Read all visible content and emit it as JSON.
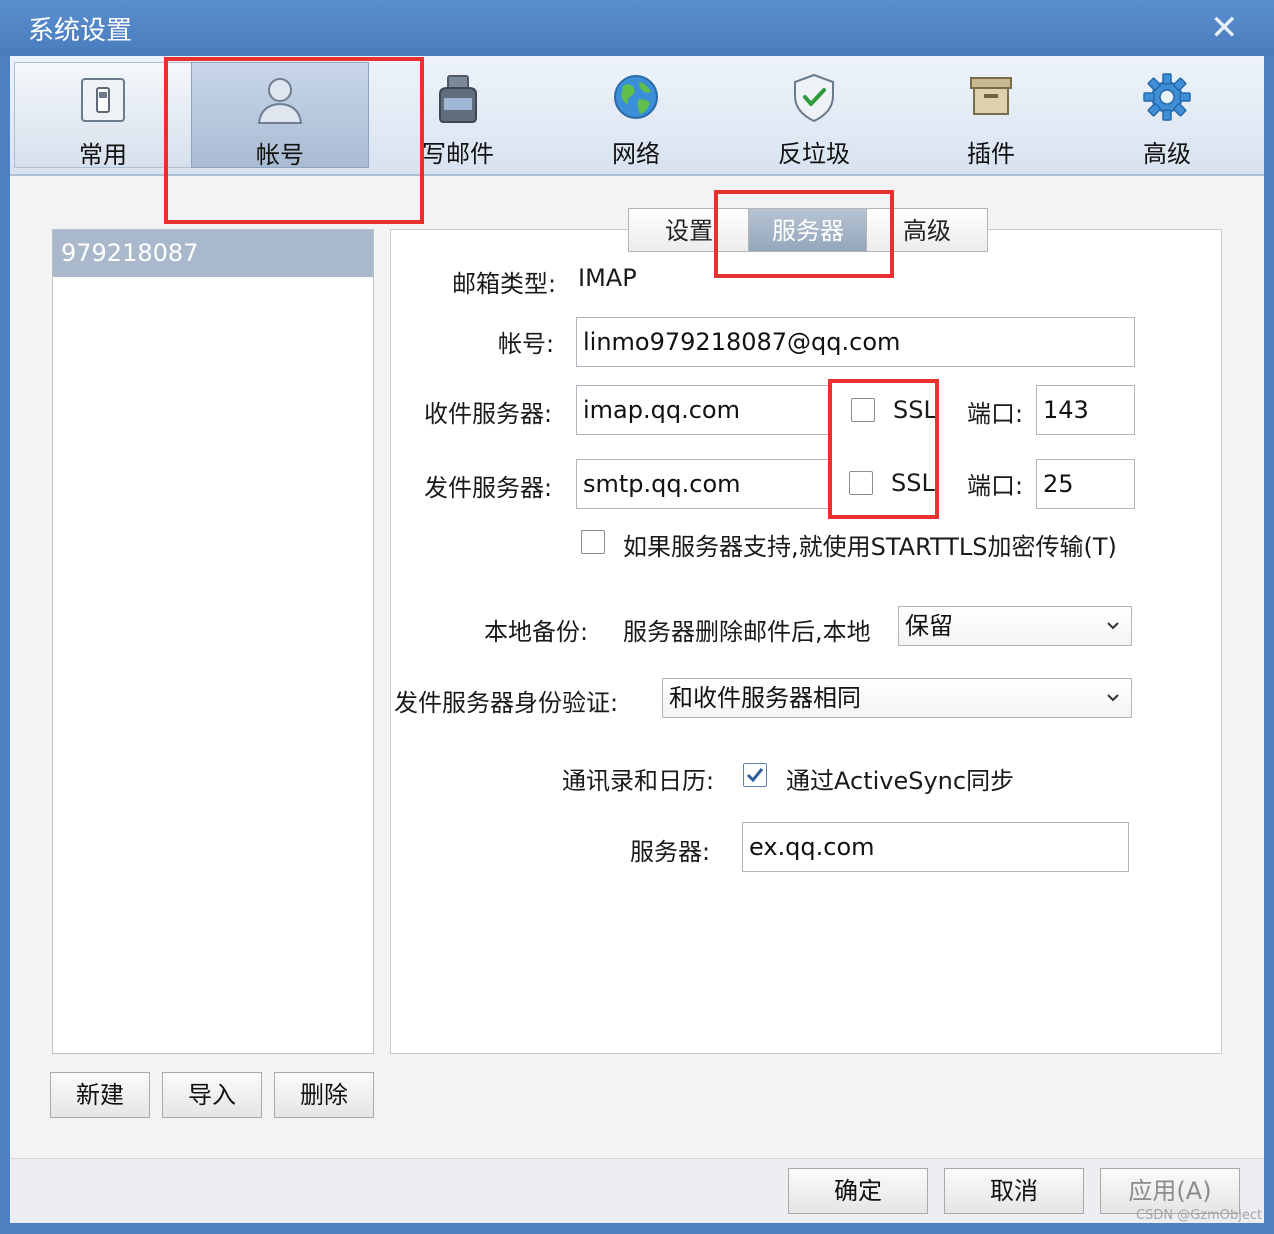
{
  "window": {
    "title": "系统设置",
    "close_glyph": "✕"
  },
  "toolbar": {
    "items": [
      {
        "label": "常用",
        "icon": "switch-icon"
      },
      {
        "label": "帐号",
        "icon": "user-icon"
      },
      {
        "label": "写邮件",
        "icon": "ink-bottle-icon"
      },
      {
        "label": "网络",
        "icon": "globe-icon"
      },
      {
        "label": "反垃圾",
        "icon": "shield-icon"
      },
      {
        "label": "插件",
        "icon": "box-icon"
      },
      {
        "label": "高级",
        "icon": "gear-icon"
      }
    ],
    "active": "帐号"
  },
  "accounts": {
    "items": [
      "979218087"
    ],
    "selected": "979218087"
  },
  "account_buttons": {
    "new": "新建",
    "import": "导入",
    "delete": "删除"
  },
  "tabs": {
    "items": [
      "设置",
      "服务器",
      "高级"
    ],
    "active": "服务器"
  },
  "server": {
    "mailbox_type_label": "邮箱类型:",
    "mailbox_type_value": "IMAP",
    "account_label": "帐号:",
    "account_value": "linmo979218087@qq.com",
    "incoming_label": "收件服务器:",
    "incoming_value": "imap.qq.com",
    "incoming_ssl_label": "SSL",
    "incoming_ssl_checked": false,
    "incoming_port_label": "端口:",
    "incoming_port_value": "143",
    "outgoing_label": "发件服务器:",
    "outgoing_value": "smtp.qq.com",
    "outgoing_ssl_label": "SSL",
    "outgoing_ssl_checked": false,
    "outgoing_port_label": "端口:",
    "outgoing_port_value": "25",
    "starttls_label": "如果服务器支持,就使用STARTTLS加密传输(T)",
    "starttls_checked": false,
    "local_backup_label": "本地备份:",
    "local_backup_desc": "服务器删除邮件后,本地",
    "local_backup_value": "保留",
    "smtp_auth_label": "发件服务器身份验证:",
    "smtp_auth_value": "和收件服务器相同",
    "contacts_label": "通讯录和日历:",
    "activesync_label": "通过ActiveSync同步",
    "activesync_checked": true,
    "sync_server_label": "服务器:",
    "sync_server_value": "ex.qq.com"
  },
  "dialog_buttons": {
    "ok": "确定",
    "cancel": "取消",
    "apply": "应用(A)"
  },
  "watermark": "CSDN @GzmObject",
  "colors": {
    "accent": "#4d80bf",
    "highlight": "#e8302e",
    "selection": "#a9b9cb"
  }
}
